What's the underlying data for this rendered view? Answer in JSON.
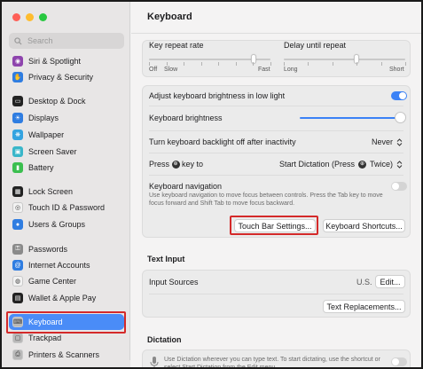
{
  "sidebar": {
    "search_placeholder": "Search",
    "items": [
      {
        "label": "Siri & Spotlight",
        "icon": "siri-icon",
        "color": "#8e44ad"
      },
      {
        "label": "Privacy & Security",
        "icon": "hand-icon",
        "color": "#2f7de1"
      },
      {
        "label": "Desktop & Dock",
        "icon": "dock-icon",
        "color": "#222222"
      },
      {
        "label": "Displays",
        "icon": "display-icon",
        "color": "#2f7de1"
      },
      {
        "label": "Wallpaper",
        "icon": "wallpaper-icon",
        "color": "#34a3e0"
      },
      {
        "label": "Screen Saver",
        "icon": "screensaver-icon",
        "color": "#39b6c9"
      },
      {
        "label": "Battery",
        "icon": "battery-icon",
        "color": "#3bbf4f"
      },
      {
        "label": "Lock Screen",
        "icon": "lock-icon",
        "color": "#222222"
      },
      {
        "label": "Touch ID & Password",
        "icon": "fingerprint-icon",
        "color": "#f2f2f2"
      },
      {
        "label": "Users & Groups",
        "icon": "users-icon",
        "color": "#2f7de1"
      },
      {
        "label": "Passwords",
        "icon": "key-icon",
        "color": "#8a8a8a"
      },
      {
        "label": "Internet Accounts",
        "icon": "at-icon",
        "color": "#2f7de1"
      },
      {
        "label": "Game Center",
        "icon": "gamecenter-icon",
        "color": "#f2f2f2"
      },
      {
        "label": "Wallet & Apple Pay",
        "icon": "wallet-icon",
        "color": "#222222"
      },
      {
        "label": "Keyboard",
        "icon": "keyboard-icon",
        "color": "#b8b8b8",
        "selected": true
      },
      {
        "label": "Trackpad",
        "icon": "trackpad-icon",
        "color": "#b8b8b8"
      },
      {
        "label": "Printers & Scanners",
        "icon": "printer-icon",
        "color": "#b8b8b8"
      }
    ]
  },
  "main": {
    "title": "Keyboard",
    "repeat": {
      "key_repeat_label": "Key repeat rate",
      "delay_label": "Delay until repeat",
      "key_repeat_min_left": "Off",
      "key_repeat_min_right": "Slow",
      "key_repeat_max": "Fast",
      "delay_min": "Long",
      "delay_max": "Short",
      "key_repeat_value_fraction": 0.86,
      "delay_value_fraction": 0.6
    },
    "settings": {
      "adjust_brightness_label": "Adjust keyboard brightness in low light",
      "adjust_brightness_on": true,
      "brightness_label": "Keyboard brightness",
      "brightness_fraction": 1.0,
      "backlight_off_label": "Turn keyboard backlight off after inactivity",
      "backlight_off_value": "Never",
      "press_key_label_pre": "Press",
      "press_key_label_post": "key to",
      "press_key_value_pre": "Start Dictation (Press",
      "press_key_value_post": "Twice)",
      "keyboard_nav_label": "Keyboard navigation",
      "keyboard_nav_help": "Use keyboard navigation to move focus between controls. Press the Tab key to move focus forward and Shift Tab to move focus backward.",
      "keyboard_nav_on": false,
      "touch_bar_button": "Touch Bar Settings...",
      "shortcuts_button": "Keyboard Shortcuts..."
    },
    "text_input": {
      "section_title": "Text Input",
      "input_sources_label": "Input Sources",
      "input_sources_value": "U.S.",
      "edit_button": "Edit...",
      "replacements_button": "Text Replacements..."
    },
    "dictation": {
      "section_title": "Dictation",
      "help": "Use Dictation wherever you can type text. To start dictating, use the shortcut or select Start Dictation from the Edit menu."
    },
    "accent_color": "#3b82f6",
    "highlight_color": "#d42a2a"
  }
}
